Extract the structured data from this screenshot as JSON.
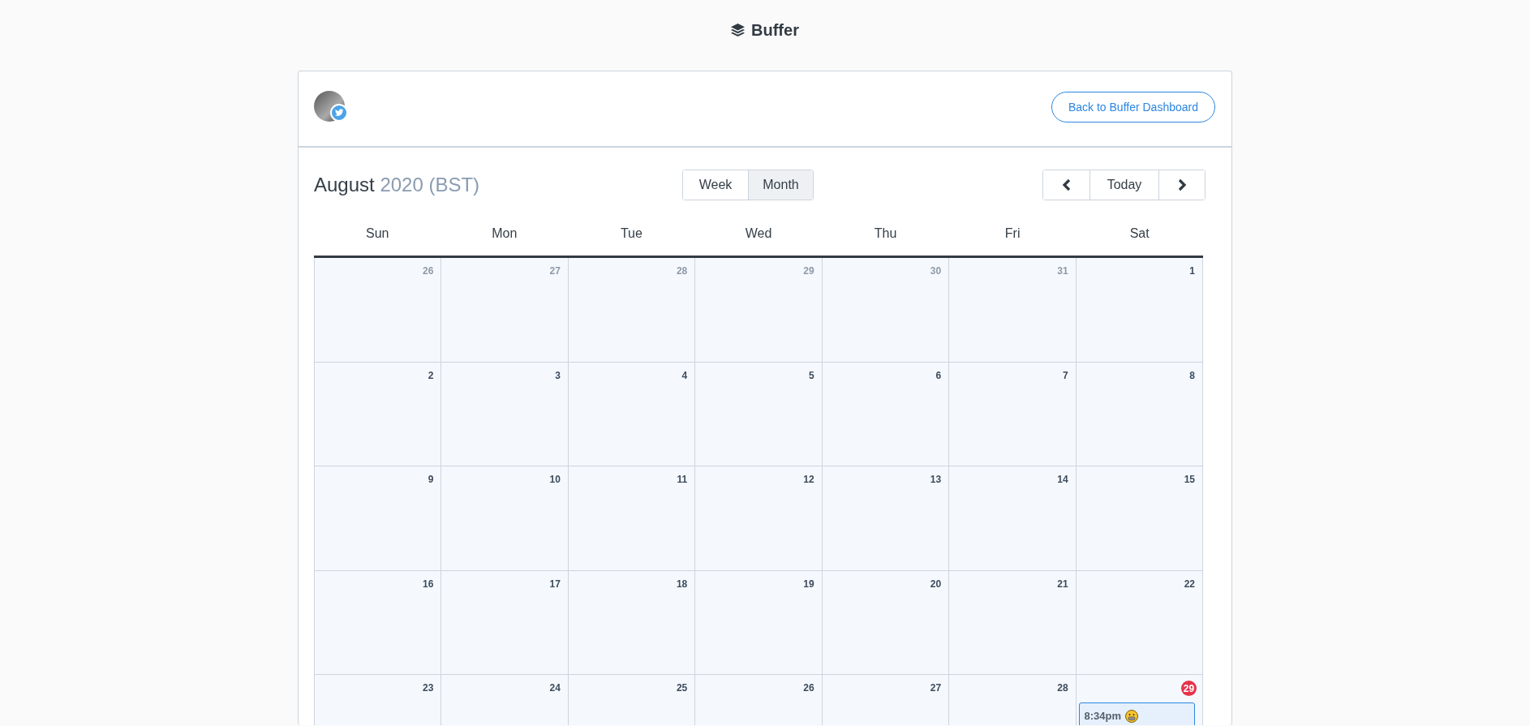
{
  "brand": {
    "name": "Buffer"
  },
  "back_button": "Back to Buffer Dashboard",
  "title": {
    "month": "August",
    "year_zone": "2020 (BST)"
  },
  "views": [
    {
      "label": "Week",
      "selected": false
    },
    {
      "label": "Month",
      "selected": true
    }
  ],
  "nav": {
    "today": "Today"
  },
  "weekdays": [
    "Sun",
    "Mon",
    "Tue",
    "Wed",
    "Thu",
    "Fri",
    "Sat"
  ],
  "weeks": [
    [
      {
        "label": "26",
        "muted": true,
        "today": false
      },
      {
        "label": "27",
        "muted": true,
        "today": false
      },
      {
        "label": "28",
        "muted": true,
        "today": false
      },
      {
        "label": "29",
        "muted": true,
        "today": false
      },
      {
        "label": "30",
        "muted": true,
        "today": false
      },
      {
        "label": "31",
        "muted": true,
        "today": false
      },
      {
        "label": "1",
        "muted": false,
        "today": false
      }
    ],
    [
      {
        "label": "2",
        "muted": false,
        "today": false
      },
      {
        "label": "3",
        "muted": false,
        "today": false
      },
      {
        "label": "4",
        "muted": false,
        "today": false
      },
      {
        "label": "5",
        "muted": false,
        "today": false
      },
      {
        "label": "6",
        "muted": false,
        "today": false
      },
      {
        "label": "7",
        "muted": false,
        "today": false
      },
      {
        "label": "8",
        "muted": false,
        "today": false
      }
    ],
    [
      {
        "label": "9",
        "muted": false,
        "today": false
      },
      {
        "label": "10",
        "muted": false,
        "today": false
      },
      {
        "label": "11",
        "muted": false,
        "today": false
      },
      {
        "label": "12",
        "muted": false,
        "today": false
      },
      {
        "label": "13",
        "muted": false,
        "today": false
      },
      {
        "label": "14",
        "muted": false,
        "today": false
      },
      {
        "label": "15",
        "muted": false,
        "today": false
      }
    ],
    [
      {
        "label": "16",
        "muted": false,
        "today": false
      },
      {
        "label": "17",
        "muted": false,
        "today": false
      },
      {
        "label": "18",
        "muted": false,
        "today": false
      },
      {
        "label": "19",
        "muted": false,
        "today": false
      },
      {
        "label": "20",
        "muted": false,
        "today": false
      },
      {
        "label": "21",
        "muted": false,
        "today": false
      },
      {
        "label": "22",
        "muted": false,
        "today": false
      }
    ],
    [
      {
        "label": "23",
        "muted": false,
        "today": false
      },
      {
        "label": "24",
        "muted": false,
        "today": false
      },
      {
        "label": "25",
        "muted": false,
        "today": false
      },
      {
        "label": "26",
        "muted": false,
        "today": false
      },
      {
        "label": "27",
        "muted": false,
        "today": false
      },
      {
        "label": "28",
        "muted": false,
        "today": false
      },
      {
        "label": "29",
        "muted": false,
        "today": true,
        "events": [
          {
            "time": "8:34pm"
          }
        ]
      }
    ]
  ]
}
